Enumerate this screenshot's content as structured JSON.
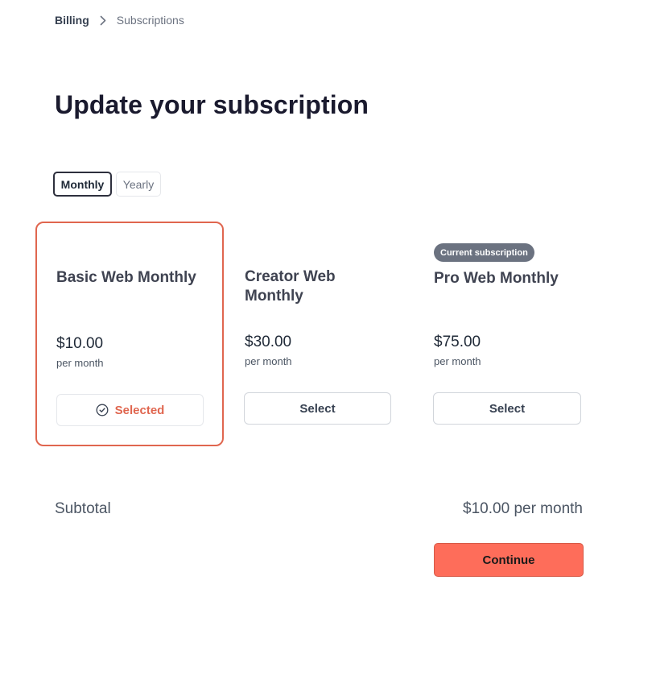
{
  "breadcrumb": {
    "root": "Billing",
    "current": "Subscriptions"
  },
  "page": {
    "title": "Update your subscription"
  },
  "period_toggle": {
    "options": [
      "Monthly",
      "Yearly"
    ],
    "selected": "Monthly"
  },
  "plans": [
    {
      "name": "Basic Web Monthly",
      "price": "$10.00",
      "period": "per month",
      "button_label": "Selected",
      "badge": ""
    },
    {
      "name": "Creator Web Monthly",
      "price": "$30.00",
      "period": "per month",
      "button_label": "Select",
      "badge": ""
    },
    {
      "name": "Pro Web Monthly",
      "price": "$75.00",
      "period": "per month",
      "button_label": "Select",
      "badge": "Current subscription"
    }
  ],
  "summary": {
    "subtotal_label": "Subtotal",
    "subtotal_value": "$10.00 per month"
  },
  "actions": {
    "continue_label": "Continue"
  },
  "colors": {
    "accent": "#fe6d5a",
    "selected_border": "#e0664f",
    "badge_bg": "#6b7280"
  },
  "icons": {
    "breadcrumb_separator": "chevron-right-icon",
    "selected_indicator": "check-circle-icon"
  }
}
